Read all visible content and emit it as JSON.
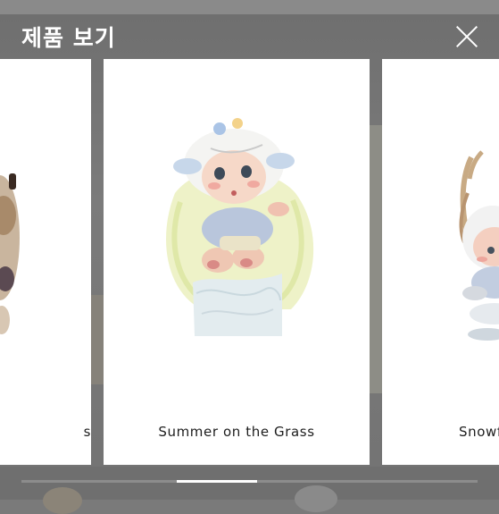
{
  "header": {
    "title": "제품 보기",
    "close_icon": "close-icon"
  },
  "carousel": {
    "cards": [
      {
        "caption": "s"
      },
      {
        "caption": "Summer on the Grass"
      },
      {
        "caption": "Snowf"
      }
    ],
    "position": {
      "current": 2,
      "total": 3
    }
  },
  "colors": {
    "overlay": "#7a7a7a",
    "card": "#ffffff",
    "title_text": "#ffffff",
    "pager_active": "#ffffff"
  }
}
